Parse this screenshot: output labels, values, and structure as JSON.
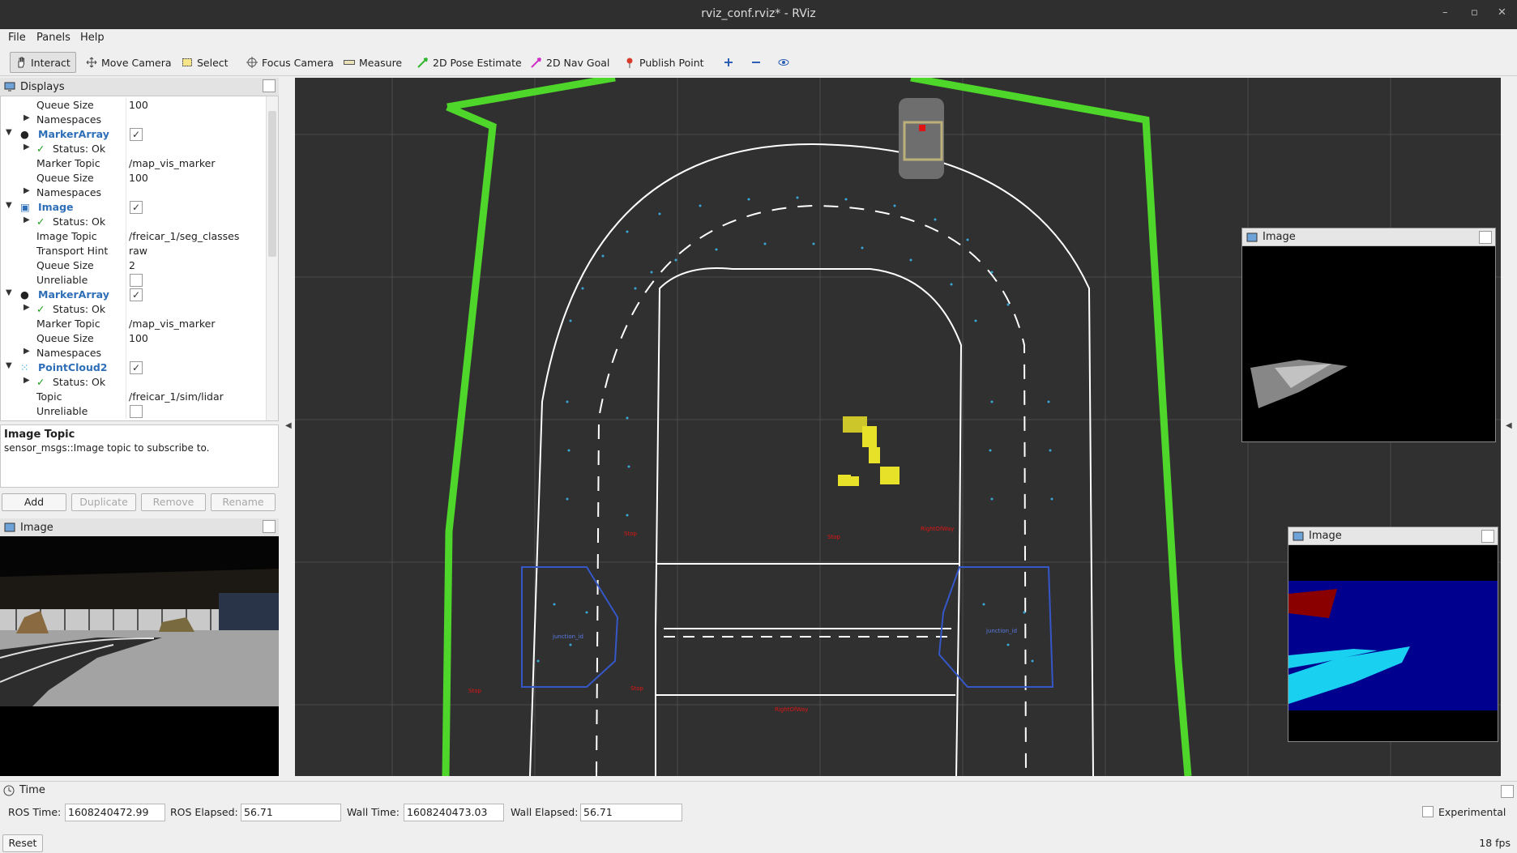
{
  "window": {
    "title": "rviz_conf.rviz* - RViz",
    "controls": [
      "–",
      "▫",
      "✕"
    ]
  },
  "menu": {
    "file": "File",
    "panels": "Panels",
    "help": "Help"
  },
  "toolbar": {
    "interact": "Interact",
    "move_camera": "Move Camera",
    "select": "Select",
    "focus_camera": "Focus Camera",
    "measure": "Measure",
    "pose_estimate": "2D Pose Estimate",
    "nav_goal": "2D Nav Goal",
    "publish_point": "Publish Point"
  },
  "displays": {
    "title": "Displays",
    "rows": [
      {
        "label": "Queue Size",
        "value": "100"
      },
      {
        "label": "Namespaces",
        "value": ""
      },
      {
        "label": "MarkerArray",
        "value": ""
      },
      {
        "label": "Status: Ok",
        "value": ""
      },
      {
        "label": "Marker Topic",
        "value": "/map_vis_marker"
      },
      {
        "label": "Queue Size",
        "value": "100"
      },
      {
        "label": "Namespaces",
        "value": ""
      },
      {
        "label": "Image",
        "value": ""
      },
      {
        "label": "Status: Ok",
        "value": ""
      },
      {
        "label": "Image Topic",
        "value": "/freicar_1/seg_classes"
      },
      {
        "label": "Transport Hint",
        "value": "raw"
      },
      {
        "label": "Queue Size",
        "value": "2"
      },
      {
        "label": "Unreliable",
        "value": ""
      },
      {
        "label": "MarkerArray",
        "value": ""
      },
      {
        "label": "Status: Ok",
        "value": ""
      },
      {
        "label": "Marker Topic",
        "value": "/map_vis_marker"
      },
      {
        "label": "Queue Size",
        "value": "100"
      },
      {
        "label": "Namespaces",
        "value": ""
      },
      {
        "label": "PointCloud2",
        "value": ""
      },
      {
        "label": "Status: Ok",
        "value": ""
      },
      {
        "label": "Topic",
        "value": "/freicar_1/sim/lidar"
      },
      {
        "label": "Unreliable",
        "value": ""
      }
    ],
    "description_title": "Image Topic",
    "description_text": "sensor_msgs::Image topic to subscribe to.",
    "buttons": {
      "add": "Add",
      "duplicate": "Duplicate",
      "remove": "Remove",
      "rename": "Rename"
    }
  },
  "image_panel": {
    "title": "Image"
  },
  "overlay1": {
    "title": "Image"
  },
  "overlay2": {
    "title": "Image"
  },
  "time": {
    "title": "Time",
    "ros_time_label": "ROS Time:",
    "ros_time": "1608240472.99",
    "ros_elapsed_label": "ROS Elapsed:",
    "ros_elapsed": "56.71",
    "wall_time_label": "Wall Time:",
    "wall_time": "1608240473.03",
    "wall_elapsed_label": "Wall Elapsed:",
    "wall_elapsed": "56.71",
    "experimental": "Experimental",
    "reset": "Reset",
    "fps": "18 fps"
  },
  "map_labels": {
    "stop": "Stop",
    "right_of_way": "RightOfWay",
    "junction_a": "junction_id",
    "junction_b": "junction_id"
  },
  "colors": {
    "boundary": "#4fd62a",
    "road": "#ffffff",
    "lane_dots": "#3aa7d6",
    "lidar": "#e8e12a",
    "junction": "#3557c8",
    "stop_text": "#e01414",
    "seg_road": "#1ad0f0",
    "seg_bg": "#00008f"
  },
  "icons": [
    "monitor-icon",
    "hand-icon",
    "move-camera-icon",
    "select-icon",
    "focus-camera-icon",
    "measure-icon",
    "pose-arrow-icon",
    "nav-goal-arrow-icon",
    "pin-icon",
    "plus-icon",
    "minus-icon",
    "eye-icon",
    "clock-icon",
    "image-icon",
    "markerarray-icon",
    "pointcloud-icon"
  ]
}
